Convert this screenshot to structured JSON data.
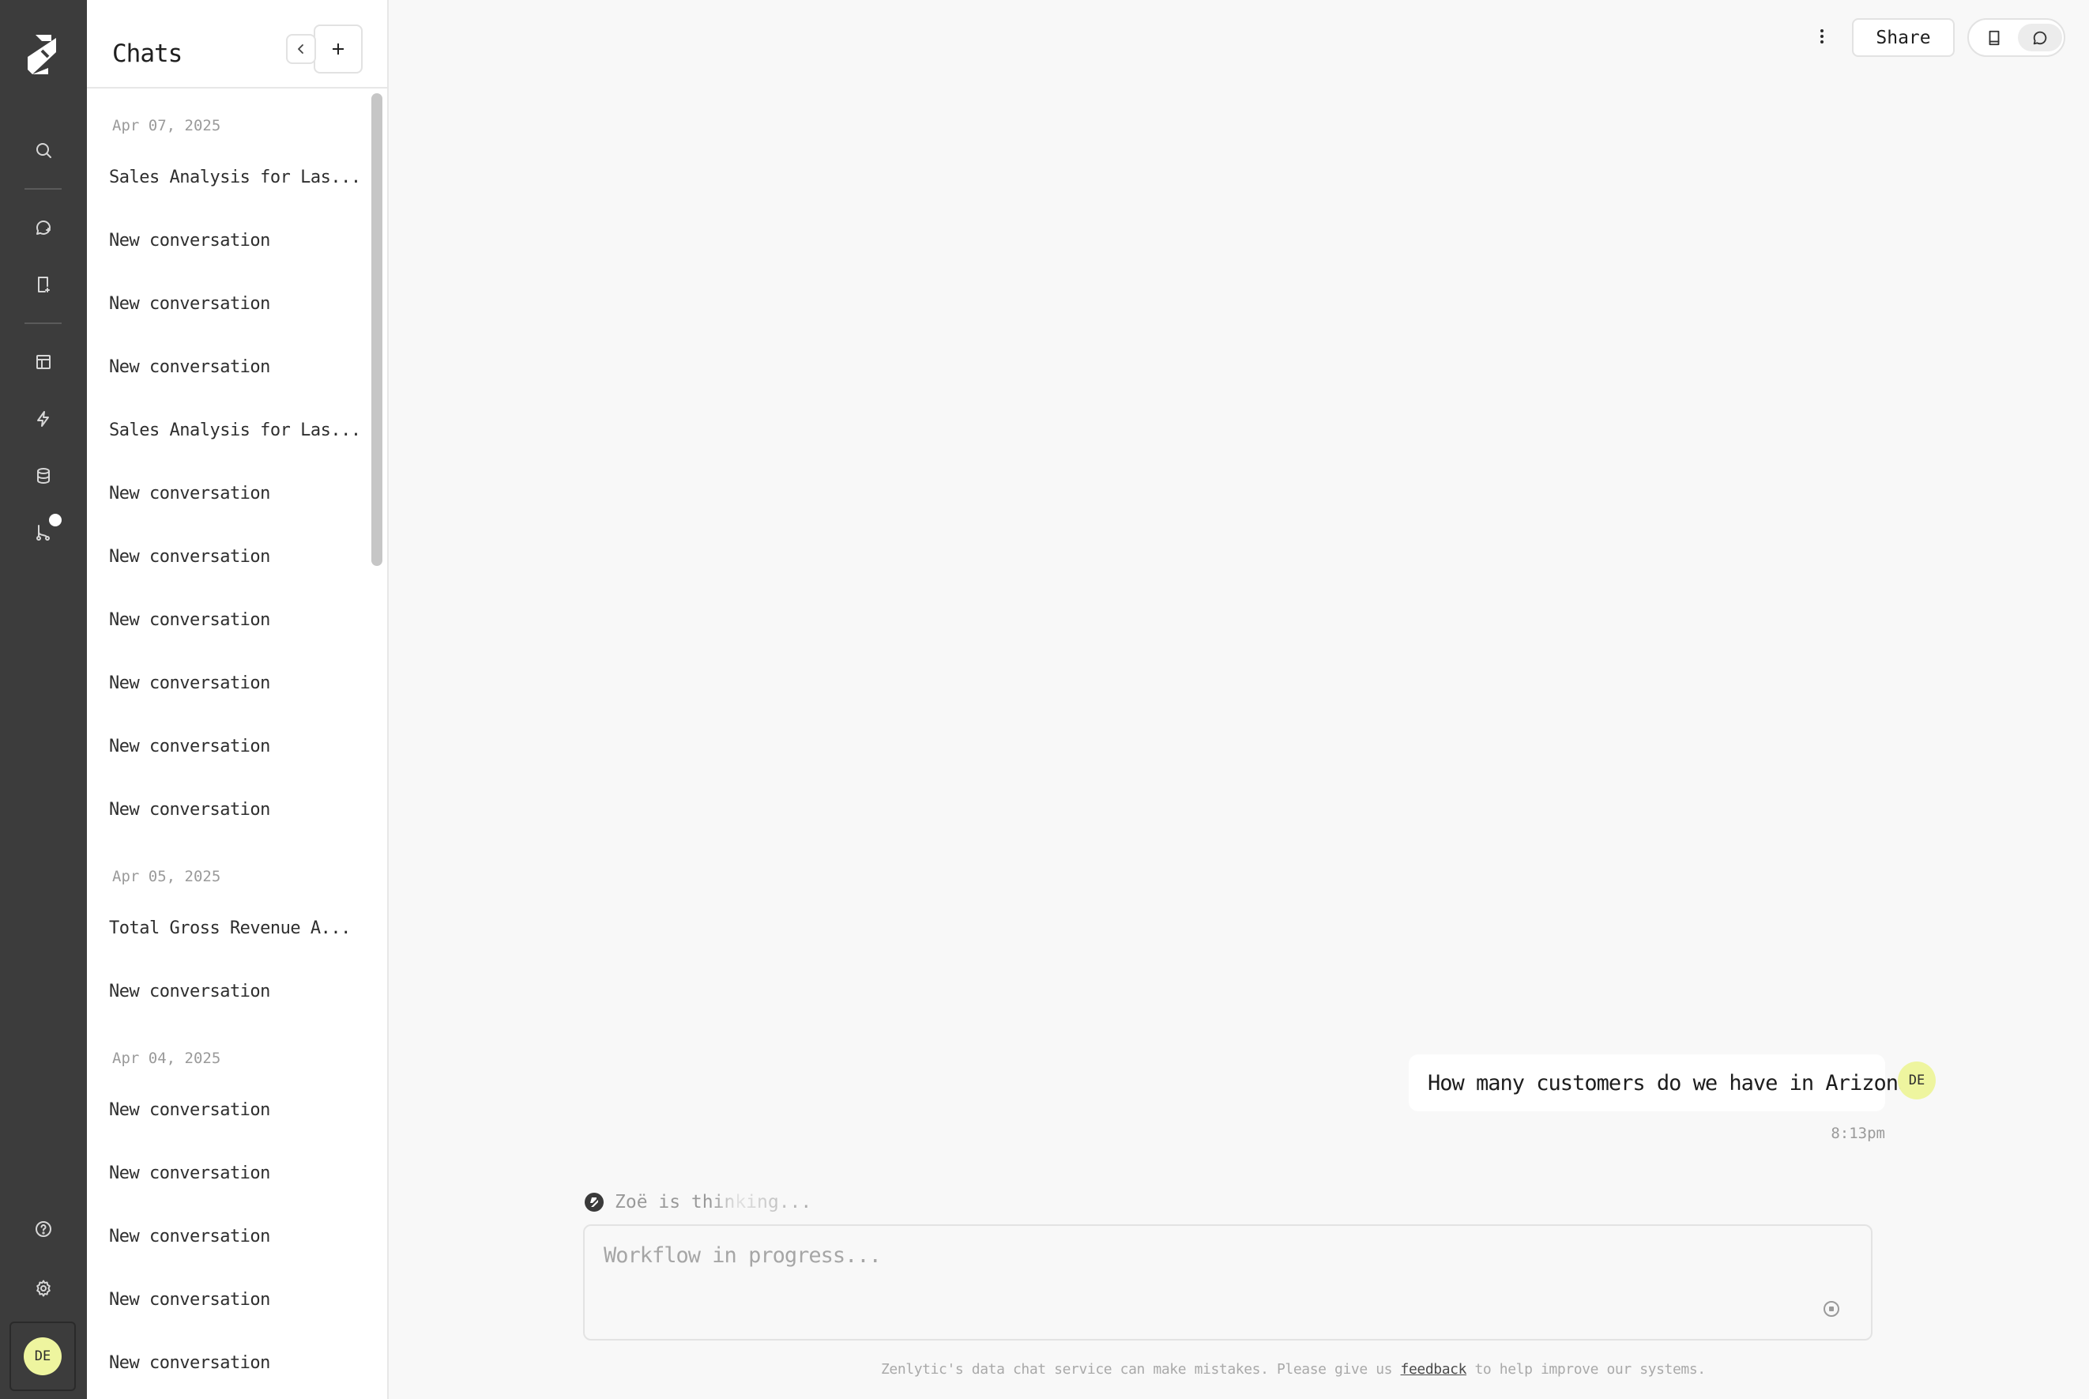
{
  "rail": {
    "logo": "zenlytic-logo",
    "icons": [
      "search-icon",
      "chat-icon",
      "notebook-icon",
      "dashboard-icon",
      "workflow-icon",
      "database-icon",
      "git-branch-icon",
      "help-icon",
      "settings-icon"
    ],
    "user_initials": "DE"
  },
  "chats_panel": {
    "title": "Chats",
    "groups": [
      {
        "date": "Apr 07, 2025",
        "items": [
          "Sales Analysis for Las...",
          "New conversation",
          "New conversation",
          "New conversation",
          "Sales Analysis for Las...",
          "New conversation",
          "New conversation",
          "New conversation",
          "New conversation",
          "New conversation",
          "New conversation"
        ]
      },
      {
        "date": "Apr 05, 2025",
        "items": [
          "Total Gross Revenue A...",
          "New conversation"
        ]
      },
      {
        "date": "Apr 04, 2025",
        "items": [
          "New conversation",
          "New conversation",
          "New conversation",
          "New conversation",
          "New conversation"
        ]
      }
    ]
  },
  "toolbar": {
    "share_label": "Share"
  },
  "conversation": {
    "user_message": "How many customers do we have in Arizona?",
    "user_initials": "DE",
    "timestamp": "8:13pm",
    "thinking_text": "Zoë is thinking..."
  },
  "input": {
    "placeholder": "Workflow in progress..."
  },
  "footer": {
    "text_before": "Zenlytic's data chat service can make mistakes. Please give us ",
    "link": "feedback",
    "text_after": " to help improve our systems."
  }
}
